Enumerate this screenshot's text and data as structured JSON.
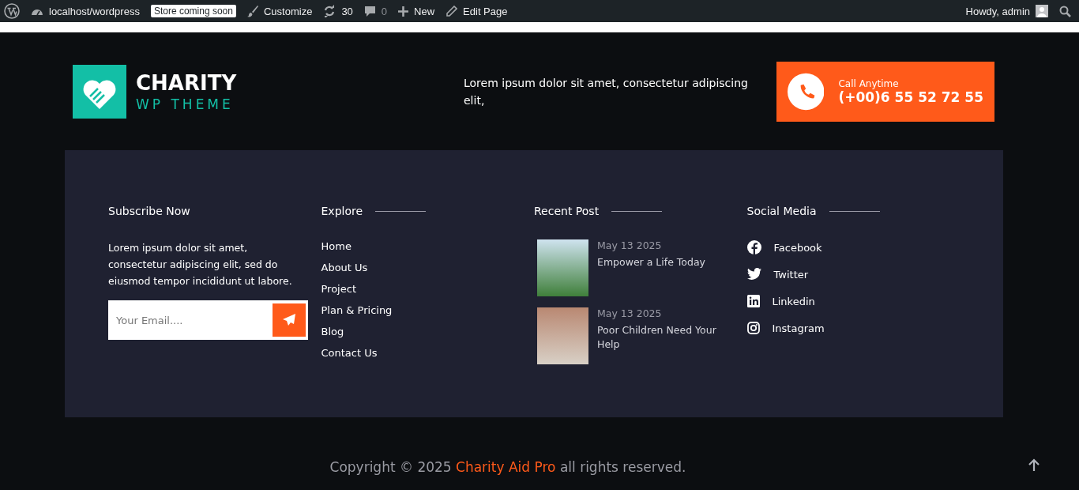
{
  "admin_bar": {
    "site": "localhost/wordpress",
    "badge": "Store coming soon",
    "customize": "Customize",
    "updates": "30",
    "comments": "0",
    "new": "New",
    "edit": "Edit Page",
    "greeting": "Howdy, admin"
  },
  "header": {
    "logo_title": "CHARITY",
    "logo_subtitle": "WP THEME",
    "tagline": "Lorem ipsum dolor sit amet, consectetur adipiscing elit,",
    "call_label": "Call Anytime",
    "call_number": "(+00)6 55 52 72 55"
  },
  "subscribe": {
    "title": "Subscribe Now",
    "text": "Lorem ipsum dolor sit amet, consectetur adipiscing elit, sed do eiusmod tempor incididunt ut labore.",
    "placeholder": "Your Email...."
  },
  "explore": {
    "title": "Explore",
    "links": [
      "Home",
      "About Us",
      "Project",
      "Plan & Pricing",
      "Blog",
      "Contact Us"
    ]
  },
  "recent": {
    "title": "Recent Post",
    "posts": [
      {
        "date": "May 13 2025",
        "title": "Empower a Life Today"
      },
      {
        "date": "May 13 2025",
        "title": "Poor Children Need Your Help"
      }
    ]
  },
  "social": {
    "title": "Social Media",
    "items": [
      {
        "kind": "facebook",
        "label": "Facebook"
      },
      {
        "kind": "twitter",
        "label": "Twitter"
      },
      {
        "kind": "linkedin",
        "label": "Linkedin"
      },
      {
        "kind": "instagram",
        "label": "Instagram"
      }
    ]
  },
  "copyright": {
    "prefix": "Copyright © 2025",
    "link": "Charity Aid Pro",
    "suffix": "all rights reserved."
  }
}
